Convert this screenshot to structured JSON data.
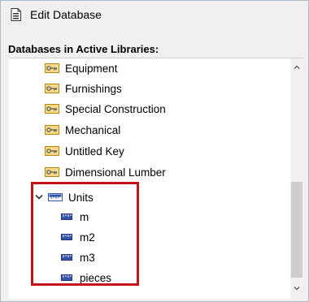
{
  "window": {
    "title": "Edit Database",
    "title_icon": "database-document-icon"
  },
  "section": {
    "label": "Databases in Active Libraries:"
  },
  "tree": {
    "key_items": [
      {
        "label": "Equipment",
        "icon": "key-icon"
      },
      {
        "label": "Furnishings",
        "icon": "key-icon"
      },
      {
        "label": "Special Construction",
        "icon": "key-icon"
      },
      {
        "label": "Mechanical",
        "icon": "key-icon"
      },
      {
        "label": "Untitled Key",
        "icon": "key-icon"
      },
      {
        "label": "Dimensional Lumber",
        "icon": "key-icon"
      }
    ],
    "units_group": {
      "label": "Units",
      "expanded": true,
      "icon": "ruler-icon",
      "children": [
        {
          "label": "m",
          "icon": "ruler-icon"
        },
        {
          "label": "m2",
          "icon": "ruler-icon"
        },
        {
          "label": "m3",
          "icon": "ruler-icon"
        },
        {
          "label": "pieces",
          "icon": "ruler-icon"
        }
      ]
    }
  },
  "colors": {
    "highlight_border": "#c4121a",
    "key_icon": "#d9a520",
    "unit_icon": "#3355aa",
    "panel_bg": "#ffffff",
    "window_bg": "#f0f0f0"
  }
}
